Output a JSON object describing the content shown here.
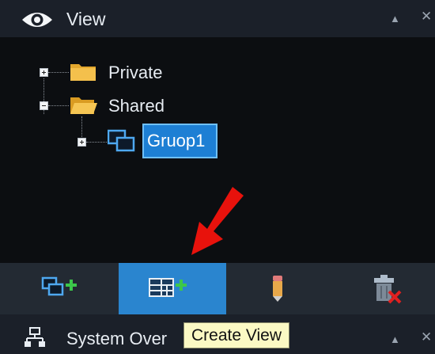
{
  "view_panel": {
    "title": "View",
    "icon": "eye-icon",
    "collapse_glyph": "▲",
    "close_glyph": "✕"
  },
  "tree": {
    "items": [
      {
        "label": "Private",
        "expanded": false,
        "icon": "folder-closed-icon"
      },
      {
        "label": "Shared",
        "expanded": true,
        "icon": "folder-open-icon",
        "children": [
          {
            "label": "Gruop1",
            "expanded": false,
            "selected": true,
            "icon": "group-windows-icon"
          }
        ]
      }
    ]
  },
  "toolbar": {
    "buttons": [
      {
        "name": "add-group",
        "icon": "add-group-icon"
      },
      {
        "name": "create-view",
        "icon": "create-view-icon",
        "active": true
      },
      {
        "name": "rename",
        "icon": "pencil-icon"
      },
      {
        "name": "delete",
        "icon": "delete-icon"
      }
    ]
  },
  "system_panel": {
    "title": "System Over",
    "icon": "network-icon",
    "collapse_glyph": "▲",
    "close_glyph": "✕"
  },
  "tooltip": {
    "text": "Create View"
  },
  "colors": {
    "accent": "#2a85cf",
    "selection": "#1d7fd4",
    "annotation_arrow": "#e8120c"
  }
}
